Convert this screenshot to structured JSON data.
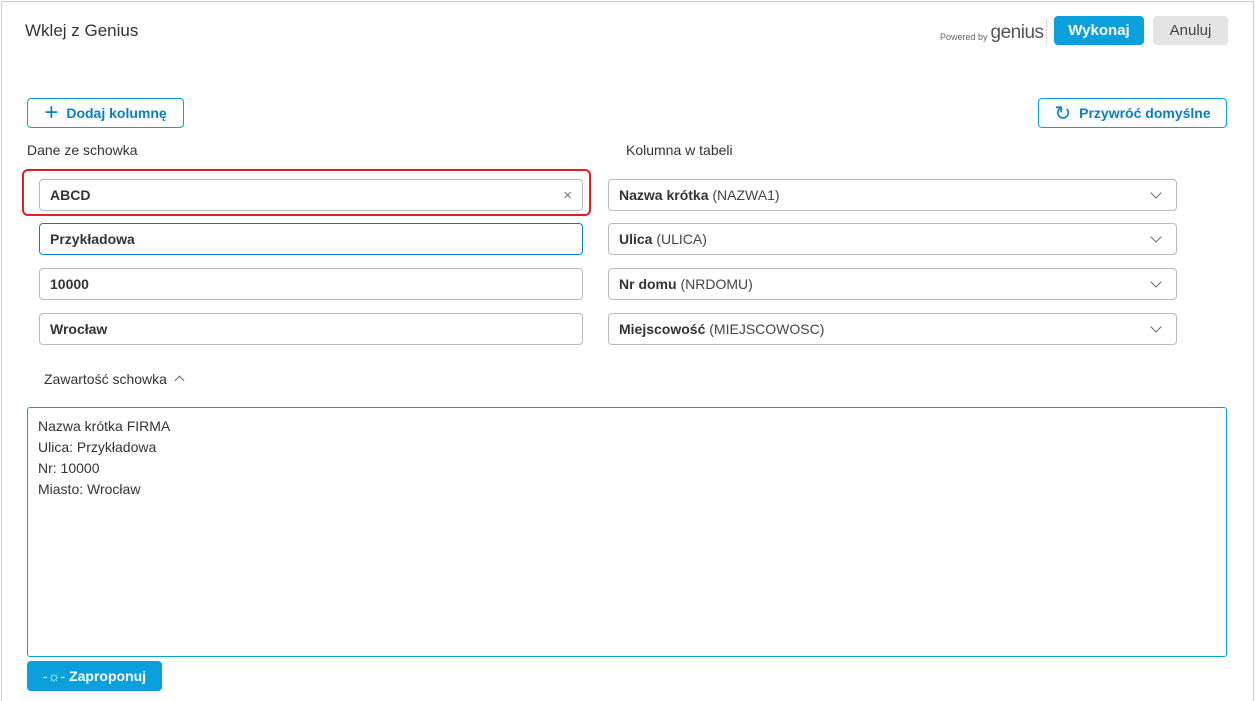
{
  "dialog": {
    "title": "Wklej z Genius",
    "powered_by": "Powered by",
    "brand": "genius",
    "execute": "Wykonaj",
    "cancel": "Anuluj"
  },
  "toolbar": {
    "add_column": "Dodaj kolumnę",
    "restore_defaults": "Przywróć domyślne"
  },
  "headers": {
    "clipboard_data": "Dane ze schowka",
    "table_column": "Kolumna w tabeli"
  },
  "rows": [
    {
      "value": "ABCD",
      "column_bold": "Nazwa krótka",
      "column_code": "(NAZWA1)"
    },
    {
      "value": "Przykładowa",
      "column_bold": "Ulica",
      "column_code": "(ULICA)"
    },
    {
      "value": "10000",
      "column_bold": "Nr domu",
      "column_code": "(NRDOMU)"
    },
    {
      "value": "Wrocław",
      "column_bold": "Miejscowość",
      "column_code": "(MIEJSCOWOSC)"
    }
  ],
  "clipboard": {
    "label": "Zawartość schowka",
    "content": "Nazwa krótka FIRMA\nUlica: Przykładowa\nNr: 10000\nMiasto: Wrocław"
  },
  "suggest": "Zaproponuj"
}
